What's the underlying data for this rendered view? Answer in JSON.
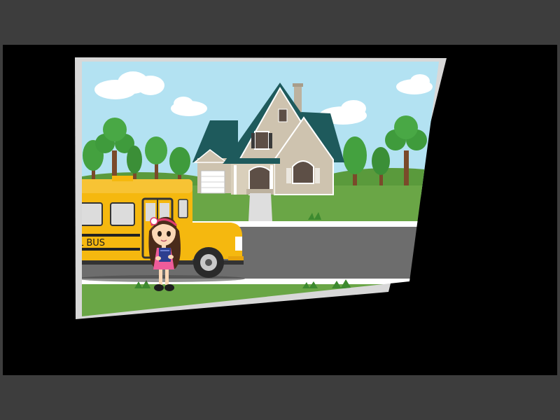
{
  "colors": {
    "frame": "#3d3d3d",
    "viewport": "#000000",
    "card_border": "#d8d8d8",
    "sky": "#b3e2f2",
    "grass": "#6aa646",
    "road": "#6d6d6d",
    "bus": "#f5b80f",
    "roof": "#1e5a5c",
    "house_wall": "#cec3af"
  },
  "scene": {
    "bus_label": "L BUS"
  }
}
